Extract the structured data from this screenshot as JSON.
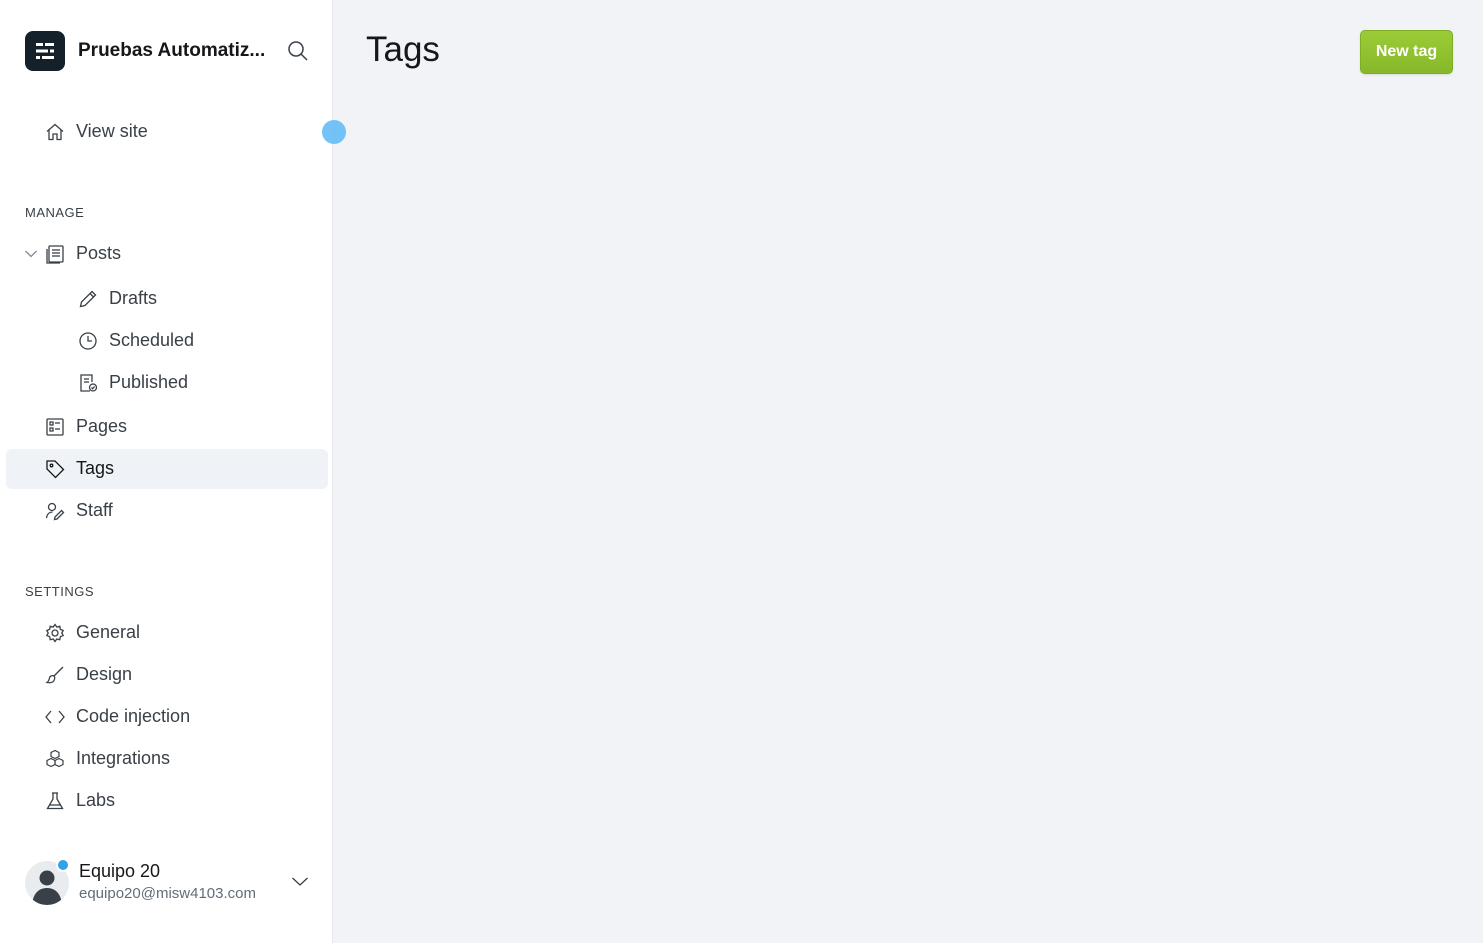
{
  "brand": {
    "name": "Pruebas Automatiz..."
  },
  "nav": {
    "view_site": "View site",
    "manage_title": "MANAGE",
    "posts": "Posts",
    "drafts": "Drafts",
    "scheduled": "Scheduled",
    "published": "Published",
    "pages": "Pages",
    "tags": "Tags",
    "staff": "Staff",
    "settings_title": "SETTINGS",
    "general": "General",
    "design": "Design",
    "code_injection": "Code injection",
    "integrations": "Integrations",
    "labs": "Labs"
  },
  "user": {
    "name": "Equipo 20",
    "email": "equipo20@misw4103.com"
  },
  "main": {
    "title": "Tags",
    "new_tag_label": "New tag"
  },
  "colors": {
    "accent": "#8cc031",
    "active_bg": "#eff2f6",
    "notification": "#30a3e6"
  },
  "icons": [
    "search-icon",
    "home-icon",
    "posts-icon",
    "pencil-icon",
    "clock-icon",
    "published-icon",
    "pages-icon",
    "tag-icon",
    "staff-icon",
    "gear-icon",
    "brush-icon",
    "code-icon",
    "integrations-icon",
    "flask-icon",
    "chevron-down-icon"
  ]
}
